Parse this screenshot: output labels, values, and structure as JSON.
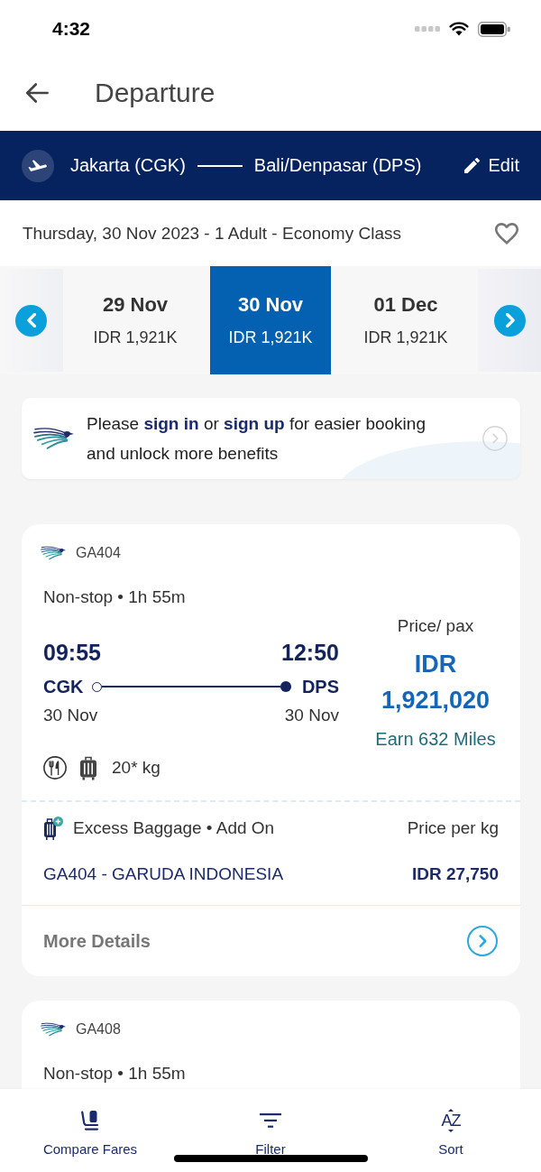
{
  "status_bar": {
    "time": "4:32"
  },
  "header": {
    "title": "Departure"
  },
  "route": {
    "origin": "Jakarta (CGK)",
    "destination": "Bali/Denpasar (DPS)",
    "edit_label": "Edit"
  },
  "trip_summary": {
    "text": "Thursday, 30 Nov 2023 - 1 Adult - Economy Class"
  },
  "date_options": [
    {
      "date": "29 Nov",
      "price": "IDR 1,921K",
      "selected": false
    },
    {
      "date": "30 Nov",
      "price": "IDR 1,921K",
      "selected": true
    },
    {
      "date": "01 Dec",
      "price": "IDR 1,921K",
      "selected": false
    }
  ],
  "sign_in_prompt": {
    "segments": [
      {
        "kind": "text",
        "text": "Please"
      },
      {
        "kind": "link",
        "text": "sign in"
      },
      {
        "kind": "text",
        "text": "or"
      },
      {
        "kind": "link",
        "text": "sign up"
      },
      {
        "kind": "text",
        "text": "for easier booking and unlock more benefits"
      }
    ]
  },
  "flights": [
    {
      "flight_number": "GA404",
      "stops": "Non-stop • 1h 55m",
      "departure_time": "09:55",
      "arrival_time": "12:50",
      "origin_code": "CGK",
      "destination_code": "DPS",
      "departure_date": "30 Nov",
      "arrival_date": "30 Nov",
      "baggage_allowance": "20* kg",
      "price_label": "Price/ pax",
      "price_currency": "IDR",
      "price_amount": "1,921,020",
      "miles": "Earn 632 Miles",
      "excess_baggage": {
        "label": "Excess Baggage • Add On",
        "price_label": "Price per kg",
        "flight": "GA404 - GARUDA INDONESIA",
        "price": "IDR 27,750"
      },
      "more_details": "More Details"
    },
    {
      "flight_number": "GA408",
      "stops": "Non-stop • 1h 55m"
    }
  ],
  "bottom_bar": [
    {
      "kind": "compare",
      "label": "Compare Fares"
    },
    {
      "kind": "filter",
      "label": "Filter"
    },
    {
      "kind": "sort",
      "label": "Sort",
      "icon_text": "AZ"
    }
  ]
}
